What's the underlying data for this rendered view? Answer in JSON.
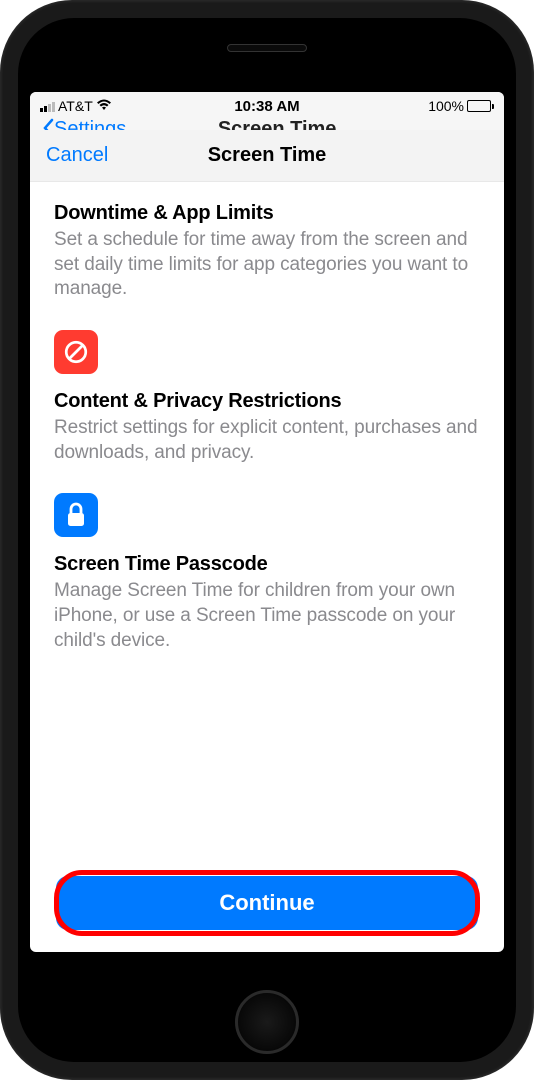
{
  "status": {
    "carrier": "AT&T",
    "time": "10:38 AM",
    "battery": "100%"
  },
  "nav_background": {
    "back_label": "Settings",
    "title": "Screen Time"
  },
  "modal": {
    "cancel_label": "Cancel",
    "title": "Screen Time"
  },
  "sections": [
    {
      "title": "Downtime & App Limits",
      "description": "Set a schedule for time away from the screen and set daily time limits for app categories you want to manage."
    },
    {
      "icon": "prohibit",
      "icon_color": "#ff3b30",
      "title": "Content & Privacy Restrictions",
      "description": "Restrict settings for explicit content, purchases and downloads, and privacy."
    },
    {
      "icon": "lock",
      "icon_color": "#007aff",
      "title": "Screen Time Passcode",
      "description": "Manage Screen Time for children from your own iPhone, or use a Screen Time passcode on your child's device."
    }
  ],
  "continue_label": "Continue"
}
